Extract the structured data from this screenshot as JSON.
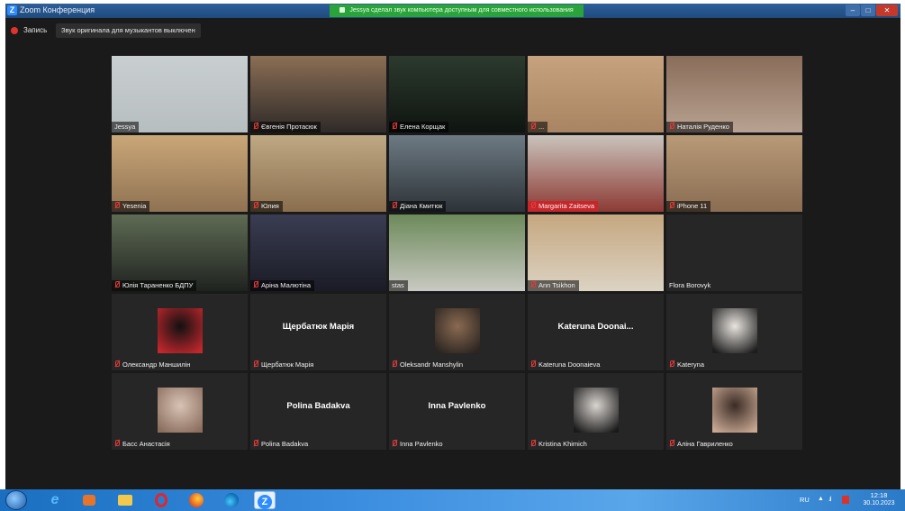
{
  "window": {
    "icon": "Z",
    "title": "Zoom Конференция",
    "share_notice": "Jessya сделал звук компьютера доступным для совместного использования"
  },
  "recording": {
    "label": "Запись",
    "original_sound": "Звук оригинала для музыкантов выключен"
  },
  "participants": [
    {
      "name": "Jessya",
      "kind": "video",
      "muted": false,
      "active": true,
      "colors": [
        "#c9cfd1",
        "#b7bec0"
      ]
    },
    {
      "name": "Євгенія Протасюк",
      "kind": "video",
      "muted": true,
      "colors": [
        "#8b6e55",
        "#2f2a28"
      ]
    },
    {
      "name": "Елена Корщак",
      "kind": "video",
      "muted": true,
      "colors": [
        "#2c3a2e",
        "#0f1410"
      ]
    },
    {
      "name": "...",
      "kind": "video",
      "muted": true,
      "colors": [
        "#c7a27e",
        "#a88462"
      ]
    },
    {
      "name": "Наталія Руденко",
      "kind": "video",
      "muted": true,
      "colors": [
        "#8a6c5a",
        "#b8a291"
      ]
    },
    {
      "name": "Yesenia",
      "kind": "video",
      "muted": true,
      "colors": [
        "#caa778",
        "#8f7253"
      ]
    },
    {
      "name": "Юлия",
      "kind": "video",
      "muted": true,
      "colors": [
        "#bfa884",
        "#8a6e4d"
      ]
    },
    {
      "name": "Діана Кмитюк",
      "kind": "video",
      "muted": true,
      "colors": [
        "#6d7a83",
        "#2d3338"
      ]
    },
    {
      "name": "Margarita Zaitseva",
      "kind": "video",
      "muted": true,
      "redtag": true,
      "colors": [
        "#c9c4bc",
        "#8d3a34"
      ]
    },
    {
      "name": "iPhone 11",
      "kind": "video",
      "muted": true,
      "colors": [
        "#b89a78",
        "#8a6d52"
      ]
    },
    {
      "name": "Юлія Тараненко БДПУ",
      "kind": "video",
      "muted": true,
      "colors": [
        "#5f6b54",
        "#1f2320"
      ]
    },
    {
      "name": "Аріна Малютіна",
      "kind": "video",
      "muted": true,
      "colors": [
        "#3a3d52",
        "#1a1b25"
      ]
    },
    {
      "name": "stas",
      "kind": "video",
      "muted": false,
      "colors": [
        "#6c8a5a",
        "#c9c9c2"
      ]
    },
    {
      "name": "Ann Tsikhon",
      "kind": "video",
      "muted": true,
      "colors": [
        "#c5a780",
        "#dcd3c3"
      ]
    },
    {
      "name": "Flora Borovyk",
      "kind": "blank",
      "muted": false
    },
    {
      "name": "Олександр Маншилін",
      "kind": "pic",
      "muted": true,
      "colors": [
        "#111111",
        "#c2272d"
      ]
    },
    {
      "name": "Щербатюк Марія",
      "display": "Щербатюк Марія",
      "kind": "text",
      "muted": true
    },
    {
      "name": "Oleksandr Manshylin",
      "kind": "pic",
      "muted": true,
      "colors": [
        "#8a6a52",
        "#2b2420"
      ]
    },
    {
      "name": "Kateruna Doonaieva",
      "display": "Kateruna  Doonai...",
      "kind": "text",
      "muted": true
    },
    {
      "name": "Kateryna",
      "kind": "pic",
      "muted": true,
      "colors": [
        "#e8e4df",
        "#1d1d1d"
      ]
    },
    {
      "name": "Басс Анастасія",
      "kind": "pic",
      "muted": true,
      "colors": [
        "#d8c3b5",
        "#8a6d5d"
      ]
    },
    {
      "name": "Polina Badakva",
      "display": "Polina Badakva",
      "kind": "text",
      "muted": true
    },
    {
      "name": "Inna Pavlenko",
      "display": "Inna Pavlenko",
      "kind": "text",
      "muted": true
    },
    {
      "name": "Kristina Khimich",
      "kind": "pic",
      "muted": true,
      "colors": [
        "#d9d4cf",
        "#1a1a1a"
      ]
    },
    {
      "name": "Аліна Гавриленко",
      "kind": "pic",
      "muted": true,
      "colors": [
        "#3a2b25",
        "#c9a893"
      ]
    }
  ],
  "taskbar": {
    "zoom_icon": "Z",
    "tray_lang": "RU",
    "tray_up": "▲",
    "tray_net": ".ıl",
    "time": "12:18",
    "date": "30.10.2023"
  }
}
